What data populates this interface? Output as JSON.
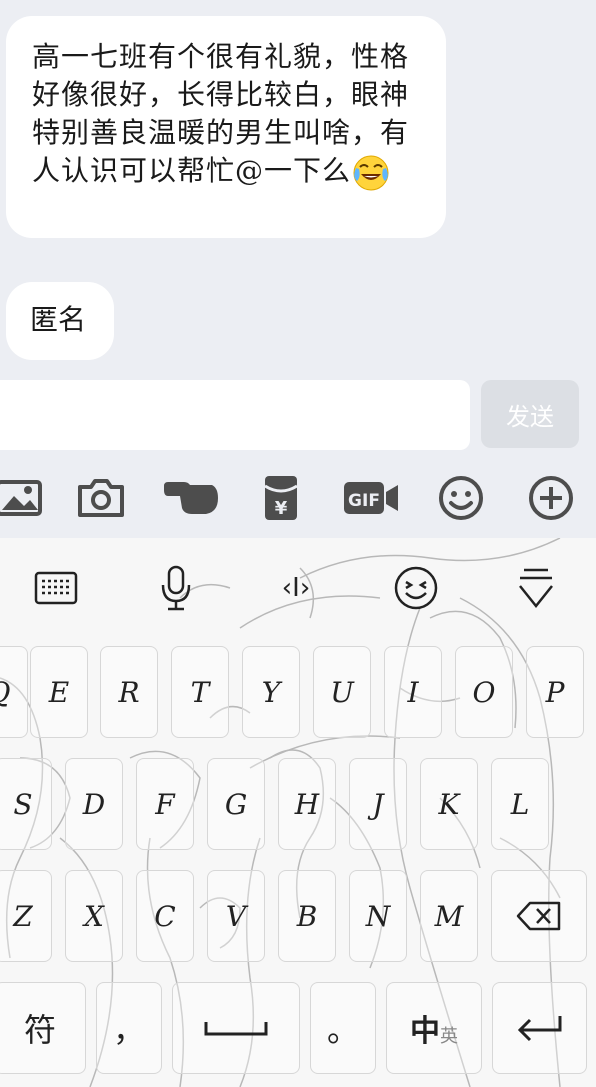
{
  "chat": {
    "message1": "高一七班有个很有礼貌，性格好像很好，长得比较白，眼神特别善良温暖的男生叫啥，有人认识可以帮忙@一下么",
    "message1_emoji": "crying-laughing-emoji",
    "message2": "匿名"
  },
  "input": {
    "placeholder": "",
    "send_label": "发送"
  },
  "toolbar": {
    "icons": [
      "image-icon",
      "camera-icon",
      "poke-hand-icon",
      "red-packet-icon",
      "gif-icon",
      "emoji-icon",
      "plus-icon"
    ],
    "red_packet_symbol": "¥",
    "gif_label": "GIF"
  },
  "keyboard": {
    "top_icons": [
      "keyboard-icon",
      "microphone-icon",
      "cursor-icon",
      "smiley-icon",
      "collapse-icon"
    ],
    "cursor_glyph": "‹I›",
    "row1": [
      "Q",
      "E",
      "R",
      "T",
      "Y",
      "U",
      "I",
      "O",
      "P"
    ],
    "row2": [
      "S",
      "D",
      "F",
      "G",
      "H",
      "J",
      "K",
      "L"
    ],
    "row3": [
      "Z",
      "X",
      "C",
      "V",
      "B",
      "N",
      "M"
    ],
    "symbol_label": "符",
    "comma_label": "，",
    "period_label": "。",
    "lang_main": "中",
    "lang_sub": "英",
    "accent_color": "#2b2b2b"
  }
}
